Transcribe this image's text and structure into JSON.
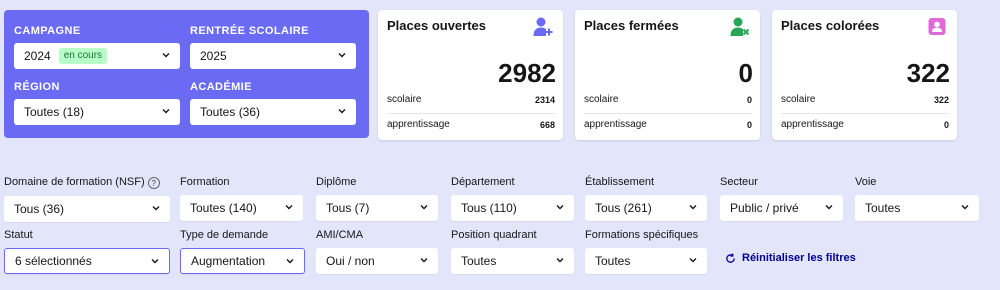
{
  "panel": {
    "campagne": {
      "label": "CAMPAGNE",
      "value": "2024",
      "badge": "en cours"
    },
    "rentree": {
      "label": "RENTRÉE SCOLAIRE",
      "value": "2025"
    },
    "region": {
      "label": "RÉGION",
      "value": "Toutes (18)"
    },
    "academie": {
      "label": "ACADÉMIE",
      "value": "Toutes (36)"
    }
  },
  "cards": [
    {
      "title": "Places ouvertes",
      "value": "2982",
      "scolaire_label": "scolaire",
      "scolaire": "2314",
      "apprentissage_label": "apprentissage",
      "apprentissage": "668",
      "icon": "user-add-icon",
      "icon_color": "#6a6af4"
    },
    {
      "title": "Places fermées",
      "value": "0",
      "scolaire_label": "scolaire",
      "scolaire": "0",
      "apprentissage_label": "apprentissage",
      "apprentissage": "0",
      "icon": "user-remove-icon",
      "icon_color": "#27a658"
    },
    {
      "title": "Places colorées",
      "value": "322",
      "scolaire_label": "scolaire",
      "scolaire": "322",
      "apprentissage_label": "apprentissage",
      "apprentissage": "0",
      "icon": "user-card-icon",
      "icon_color": "#e06ad9"
    }
  ],
  "filters": {
    "domaine": {
      "label": "Domaine de formation (NSF)",
      "value": "Tous (36)"
    },
    "formation": {
      "label": "Formation",
      "value": "Toutes (140)"
    },
    "diplome": {
      "label": "Diplôme",
      "value": "Tous (7)"
    },
    "departement": {
      "label": "Département",
      "value": "Tous (110)"
    },
    "etablissement": {
      "label": "Établissement",
      "value": "Tous (261)"
    },
    "secteur": {
      "label": "Secteur",
      "value": "Public / privé"
    },
    "voie": {
      "label": "Voie",
      "value": "Toutes"
    },
    "statut": {
      "label": "Statut",
      "value": "6 sélectionnés"
    },
    "type_demande": {
      "label": "Type de demande",
      "value": "Augmentation"
    },
    "ami_cma": {
      "label": "AMI/CMA",
      "value": "Oui / non"
    },
    "position_quadrant": {
      "label": "Position quadrant",
      "value": "Toutes"
    },
    "formations_specifiques": {
      "label": "Formations spécifiques",
      "value": "Toutes"
    }
  },
  "reset_label": "Réinitialiser les filtres",
  "colors": {
    "background": "#e3e5fb",
    "panel": "#6a6af4",
    "accent": "#000091"
  }
}
